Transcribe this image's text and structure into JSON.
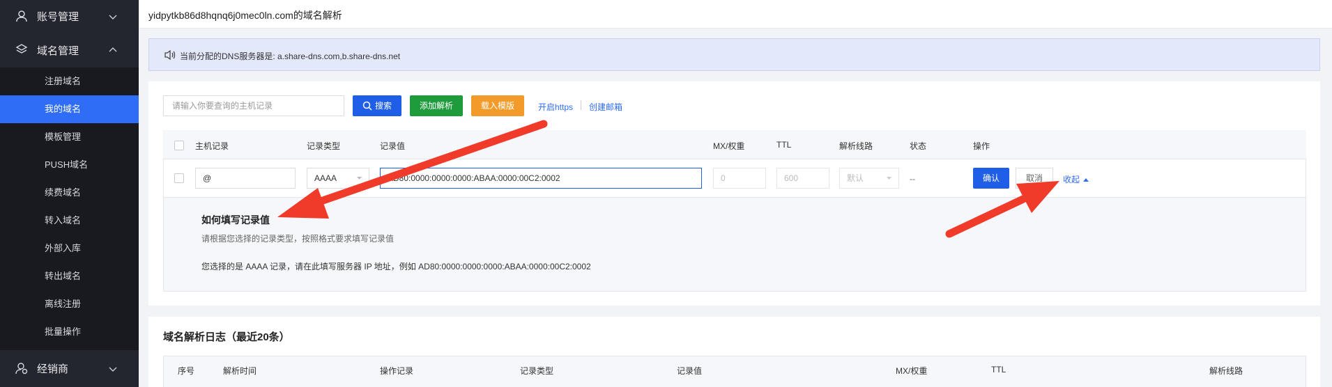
{
  "header": {
    "title": "yidpytkb86d8hqnq6j0mec0ln.com的域名解析"
  },
  "sidebar": {
    "groups": [
      {
        "label": "账号管理",
        "icon": "user-icon"
      },
      {
        "label": "域名管理",
        "icon": "layers-icon"
      },
      {
        "label": "经销商",
        "icon": "dealer-icon"
      }
    ],
    "items": [
      {
        "label": "注册域名"
      },
      {
        "label": "我的域名",
        "active": true
      },
      {
        "label": "模板管理"
      },
      {
        "label": "PUSH域名"
      },
      {
        "label": "续费域名"
      },
      {
        "label": "转入域名"
      },
      {
        "label": "外部入库"
      },
      {
        "label": "转出域名"
      },
      {
        "label": "离线注册"
      },
      {
        "label": "批量操作"
      }
    ]
  },
  "notice": {
    "text": "当前分配的DNS服务器是: a.share-dns.com,b.share-dns.net",
    "icon": "speaker-icon"
  },
  "toolbar": {
    "search_placeholder": "请输入你要查询的主机记录",
    "search_label": "搜索",
    "add_label": "添加解析",
    "template_label": "载入模版",
    "https_label": "开启https",
    "mail_label": "创建邮箱"
  },
  "table": {
    "columns": {
      "host": "主机记录",
      "type": "记录类型",
      "value": "记录值",
      "mx": "MX/权重",
      "ttl": "TTL",
      "line": "解析线路",
      "status": "状态",
      "ops": "操作"
    },
    "edit_row": {
      "host": "@",
      "type": "AAAA",
      "value": "AD80:0000:0000:0000:ABAA:0000:00C2:0002",
      "mx_placeholder": "0",
      "ttl_placeholder": "600",
      "line": "默认",
      "status": "--",
      "confirm": "确认",
      "cancel": "取消",
      "collapse": "收起"
    }
  },
  "help": {
    "title": "如何填写记录值",
    "desc": "请根据您选择的记录类型，按照格式要求填写记录值",
    "example": "您选择的是 AAAA 记录，请在此填写服务器 IP 地址，例如 AD80:0000:0000:0000:ABAA:0000:00C2:0002"
  },
  "log": {
    "title": "域名解析日志（最近20条）",
    "columns": [
      "序号",
      "解析时间",
      "操作记录",
      "记录类型",
      "记录值",
      "MX/权重",
      "TTL",
      "解析线路"
    ]
  },
  "colors": {
    "primary": "#1f5ee6",
    "success": "#1e9b3b",
    "warning": "#f29b2a",
    "sidebar": "#23262e",
    "annotation": "#f03a2a"
  }
}
